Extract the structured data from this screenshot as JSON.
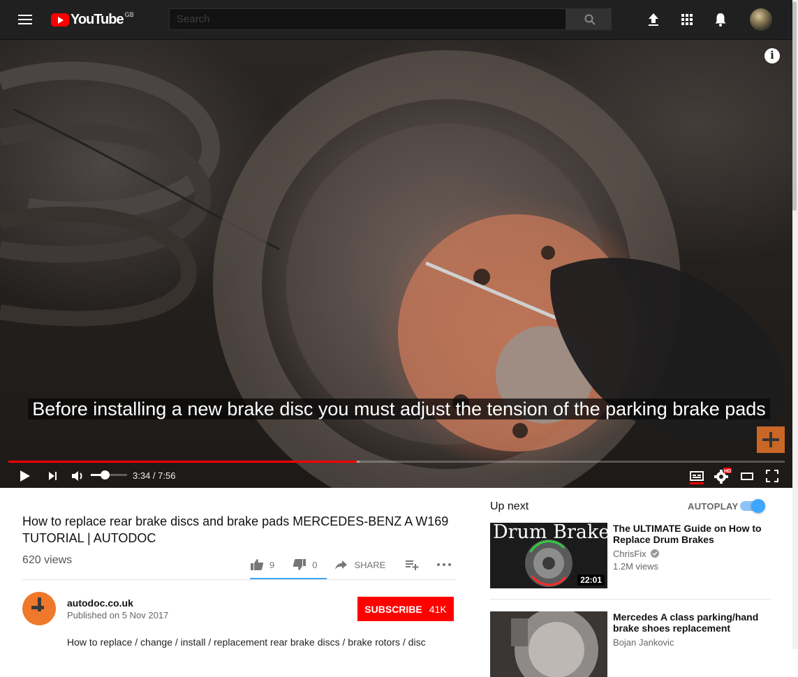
{
  "masthead": {
    "logo_text": "YouTube",
    "region": "GB",
    "search_placeholder": "Search"
  },
  "player": {
    "caption": "Before installing a new brake disc you must adjust the tension of the parking brake pads",
    "current_time": "3:34",
    "duration": "7:56",
    "time_display": "3:34 / 7:56",
    "progress_fraction": 0.449,
    "buffered_fraction": 0.452,
    "volume_fraction": 0.38,
    "quality_badge": "HD"
  },
  "video": {
    "title": "How to replace rear brake discs and brake pads MERCEDES-BENZ A W169 TUTORIAL | AUTODOC",
    "views": "620 views",
    "likes": "9",
    "dislikes": "0",
    "share_label": "SHARE"
  },
  "channel": {
    "name": "autodoc.co.uk",
    "published": "Published on 5 Nov 2017",
    "subscribe_label": "SUBSCRIBE",
    "subscriber_count": "41K",
    "description": "How to replace / change / install / replacement rear brake discs / brake rotors / disc"
  },
  "sidebar": {
    "up_next_label": "Up next",
    "autoplay_label": "AUTOPLAY",
    "autoplay_on": true,
    "recommendations": [
      {
        "title": "The ULTIMATE Guide on How to Replace Drum Brakes",
        "channel": "ChrisFix",
        "verified": true,
        "views": "1.2M views",
        "duration": "22:01",
        "thumb_text": "Drum Brakes"
      },
      {
        "title": "Mercedes A class parking/hand brake shoes replacement",
        "channel": "Bojan Jankovic"
      }
    ]
  },
  "colors": {
    "masthead_bg": "#202020",
    "brand_red": "#ff0000",
    "accent_blue": "#3ea6ff",
    "autodoc_orange": "#f0782a"
  }
}
